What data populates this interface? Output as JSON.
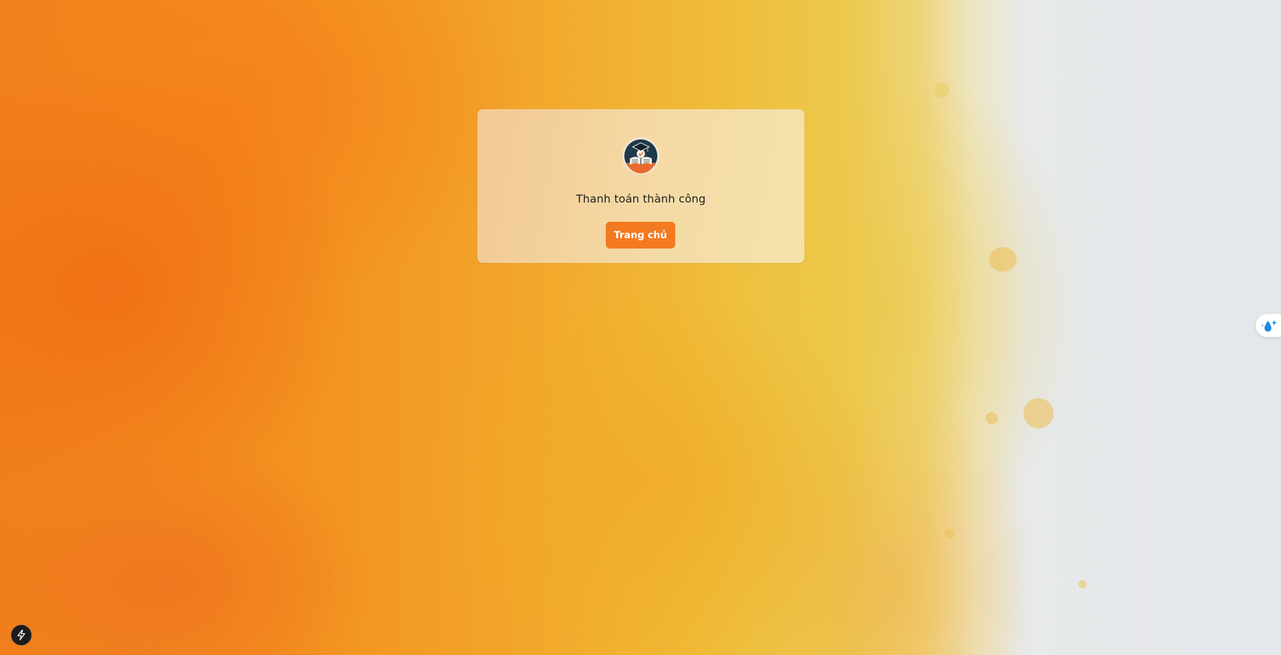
{
  "page": {
    "message": "Thanh toán thành công",
    "home_button_label": "Trang chủ"
  },
  "icons": {
    "logo": "graduation-cap-book-logo",
    "side_widget": "water-drop-sparkle-icon",
    "dev_tools": "lightning-bolt-icon"
  },
  "colors": {
    "accent": "#f47a1f",
    "card_bg": "#f3d7a6",
    "text": "#1f1f1f"
  }
}
